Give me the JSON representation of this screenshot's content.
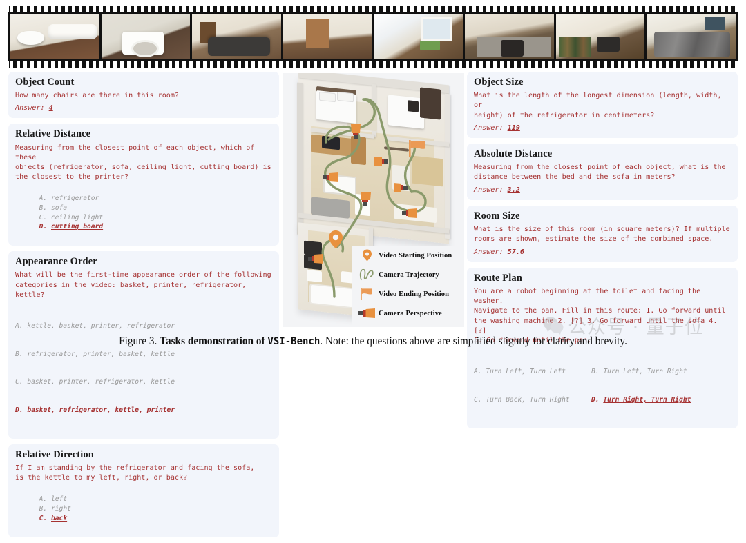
{
  "filmstrip": {
    "name": "video-frames",
    "frames": [
      {
        "label": "bathroom with toilet and bathtub"
      },
      {
        "label": "laundry room with washing machine"
      },
      {
        "label": "living room with dark sofa"
      },
      {
        "label": "hallway with coats on door"
      },
      {
        "label": "desk area with window and green chair"
      },
      {
        "label": "kitchen with oven and counter"
      },
      {
        "label": "storage area with bottles"
      },
      {
        "label": "bedroom with grey bed"
      }
    ]
  },
  "left_column": [
    {
      "title": "Object Count",
      "question": "How many chairs are there in this room?",
      "answer_label": "Answer:",
      "answer_value": "4",
      "options": null
    },
    {
      "title": "Relative Distance",
      "question": "Measuring from the closest point of each object, which of these\nobjects (refrigerator, sofa, ceiling light, cutting board) is\nthe closest to the printer?",
      "answer_label": null,
      "answer_value": null,
      "options_inline": [
        {
          "key": "A.",
          "text": "refrigerator",
          "correct": false
        },
        {
          "key": "B.",
          "text": "sofa",
          "correct": false
        },
        {
          "key": "C.",
          "text": "ceiling light",
          "correct": false
        },
        {
          "key": "D.",
          "text": "cutting board",
          "correct": true
        }
      ]
    },
    {
      "title": "Appearance Order",
      "question": "What will be the first-time appearance order of the following\ncategories in the video: basket, printer, refrigerator, kettle?",
      "options_stacked": [
        {
          "key": "A.",
          "text": "kettle, basket, printer, refrigerator",
          "correct": false
        },
        {
          "key": "B.",
          "text": "refrigerator, printer, basket, kettle",
          "correct": false
        },
        {
          "key": "C.",
          "text": "basket, printer, refrigerator, kettle",
          "correct": false
        },
        {
          "key": "D.",
          "text": "basket, refrigerator, kettle, printer",
          "correct": true
        }
      ]
    },
    {
      "title": "Relative Direction",
      "question": "If I am standing by the refrigerator and facing the sofa,\nis the kettle to my left, right, or back?",
      "options_inline": [
        {
          "key": "A.",
          "text": "left",
          "correct": false
        },
        {
          "key": "B.",
          "text": "right",
          "correct": false
        },
        {
          "key": "C.",
          "text": "back",
          "correct": true
        }
      ]
    }
  ],
  "right_column": [
    {
      "title": "Object Size",
      "question": "What is the length of the longest dimension (length, width, or\nheight) of the refrigerator in centimeters?",
      "answer_label": "Answer:",
      "answer_value": "119"
    },
    {
      "title": "Absolute Distance",
      "question": "Measuring from the closest point of each object, what is the\ndistance between the bed and the sofa in meters?",
      "answer_label": "Answer:",
      "answer_value": "3.2"
    },
    {
      "title": "Room Size",
      "question": "What is the size of this room (in square meters)? If multiple\nrooms are shown, estimate the size of the combined space.",
      "answer_label": "Answer:",
      "answer_value": "57.6"
    },
    {
      "title": "Route Plan",
      "question": "You are a robot beginning at the toilet and facing the washer.\nNavigate to the pan. Fill in this route: 1. Go forward until\nthe washing machine 2. [?] 3. Go forward until the sofa 4. [?]\n5. Go forward until the pan.",
      "options_grid": [
        [
          {
            "key": "A.",
            "text": "Turn Left, Turn Left",
            "correct": false
          },
          {
            "key": "B.",
            "text": "Turn Left, Turn Right",
            "correct": false
          }
        ],
        [
          {
            "key": "C.",
            "text": "Turn Back, Turn Right",
            "correct": false
          },
          {
            "key": "D.",
            "text": "Turn Right, Turn Right",
            "correct": true
          }
        ]
      ]
    }
  ],
  "diagram": {
    "name": "3d-floorplan",
    "legend": [
      {
        "icon": "map-pin-icon",
        "label": "Video Starting Position",
        "color": "#e8913f"
      },
      {
        "icon": "trajectory-squiggle-icon",
        "label": "Camera Trajectory",
        "color": "#8a9a6b"
      },
      {
        "icon": "flag-icon",
        "label": "Video Ending Position",
        "color": "#eb9a55"
      },
      {
        "icon": "camera-cone-icon",
        "label": "Camera Perspective",
        "color": "#e8913f"
      }
    ]
  },
  "watermark": {
    "text": "公众号 · 量子位",
    "icon": "wechat-icon"
  },
  "caption": {
    "figure_number": "Figure 3.",
    "bold_lead": "Tasks demonstration of",
    "bench_name": "VSI-Bench",
    "rest": ". Note: the questions above are simplified slightly for clarity and brevity."
  },
  "colors": {
    "card_bg": "#f2f5fb",
    "question_red": "#a63232",
    "option_grey": "#9a9a9a",
    "accent_orange": "#e8913f",
    "trajectory_green": "#8a9a6b"
  }
}
